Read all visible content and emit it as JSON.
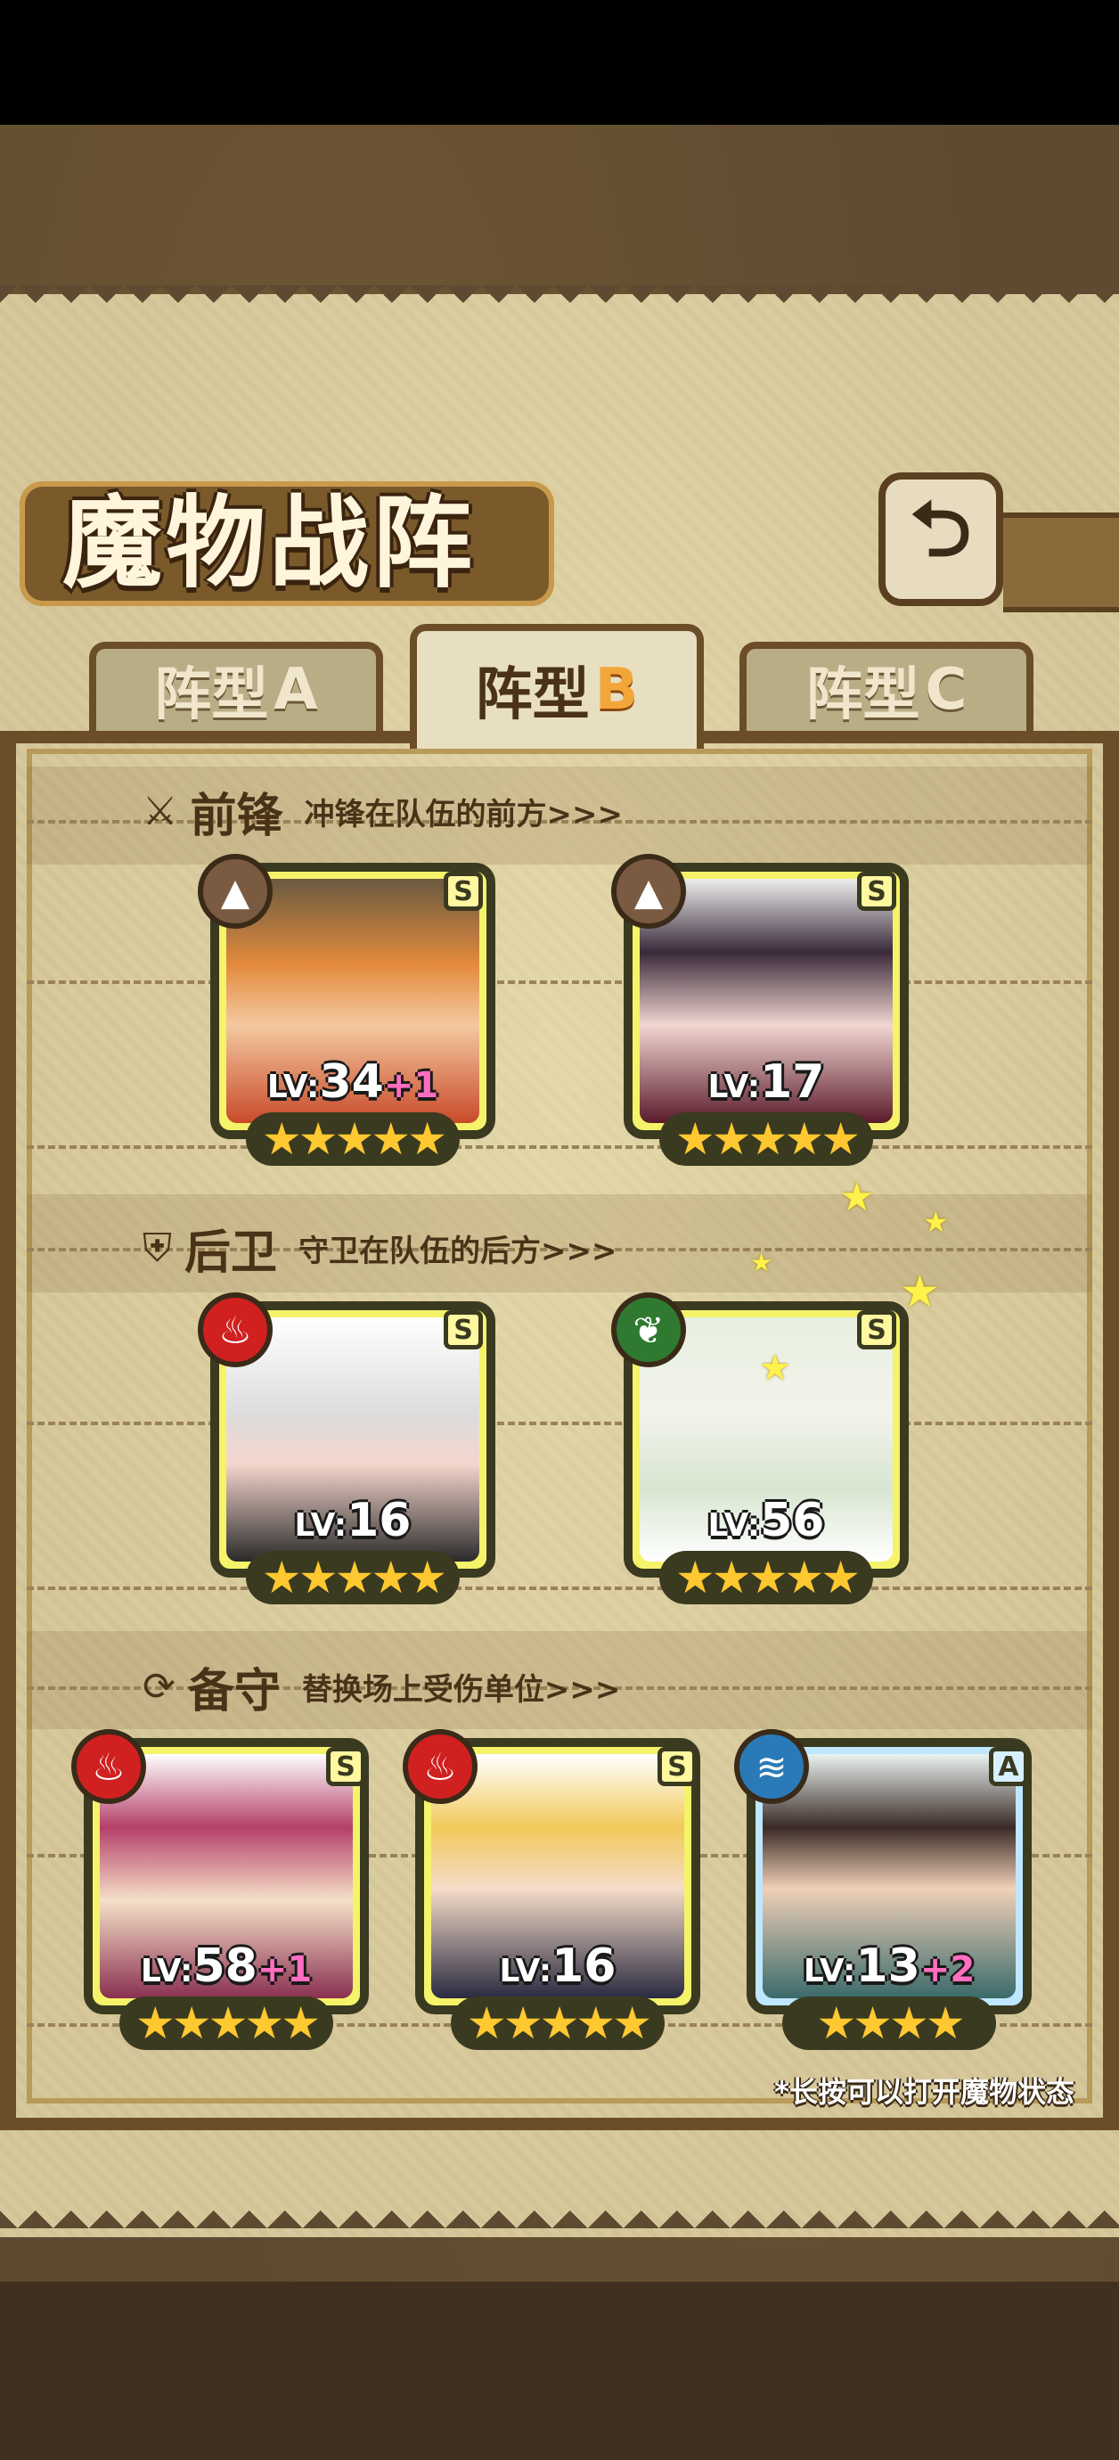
{
  "title": "魔物战阵",
  "back_icon": "return-arrow-icon",
  "tabs": [
    {
      "name": "阵型",
      "letter": "A",
      "active": false
    },
    {
      "name": "阵型",
      "letter": "B",
      "active": true
    },
    {
      "name": "阵型",
      "letter": "C",
      "active": false
    }
  ],
  "sections": [
    {
      "title": "前锋",
      "desc": "冲锋在队伍的前方>>>",
      "icon": "sword-icon"
    },
    {
      "title": "后卫",
      "desc": "守卫在队伍的后方>>>",
      "icon": "shield-icon"
    },
    {
      "title": "备守",
      "desc": "替换场上受伤单位>>>",
      "icon": "swap-icon"
    }
  ],
  "cards": [
    {
      "level": "34",
      "bonus": "+1",
      "rank": "S",
      "stars": 5,
      "element": "earth",
      "elem_color": "#7a5a40"
    },
    {
      "level": "17",
      "bonus": "",
      "rank": "S",
      "stars": 5,
      "element": "earth",
      "elem_color": "#7a5a40"
    },
    {
      "level": "16",
      "bonus": "",
      "rank": "S",
      "stars": 5,
      "element": "fire",
      "elem_color": "#d02020"
    },
    {
      "level": "56",
      "bonus": "",
      "rank": "S",
      "stars": 5,
      "element": "wind",
      "elem_color": "#2f7a30"
    },
    {
      "level": "58",
      "bonus": "+1",
      "rank": "S",
      "stars": 5,
      "element": "fire",
      "elem_color": "#d02020"
    },
    {
      "level": "16",
      "bonus": "",
      "rank": "S",
      "stars": 5,
      "element": "fire",
      "elem_color": "#d02020"
    },
    {
      "level": "13",
      "bonus": "+2",
      "rank": "A",
      "stars": 4,
      "element": "water",
      "elem_color": "#2a7ab8"
    }
  ],
  "level_prefix": "LV:",
  "hint": "*长按可以打开魔物状态"
}
